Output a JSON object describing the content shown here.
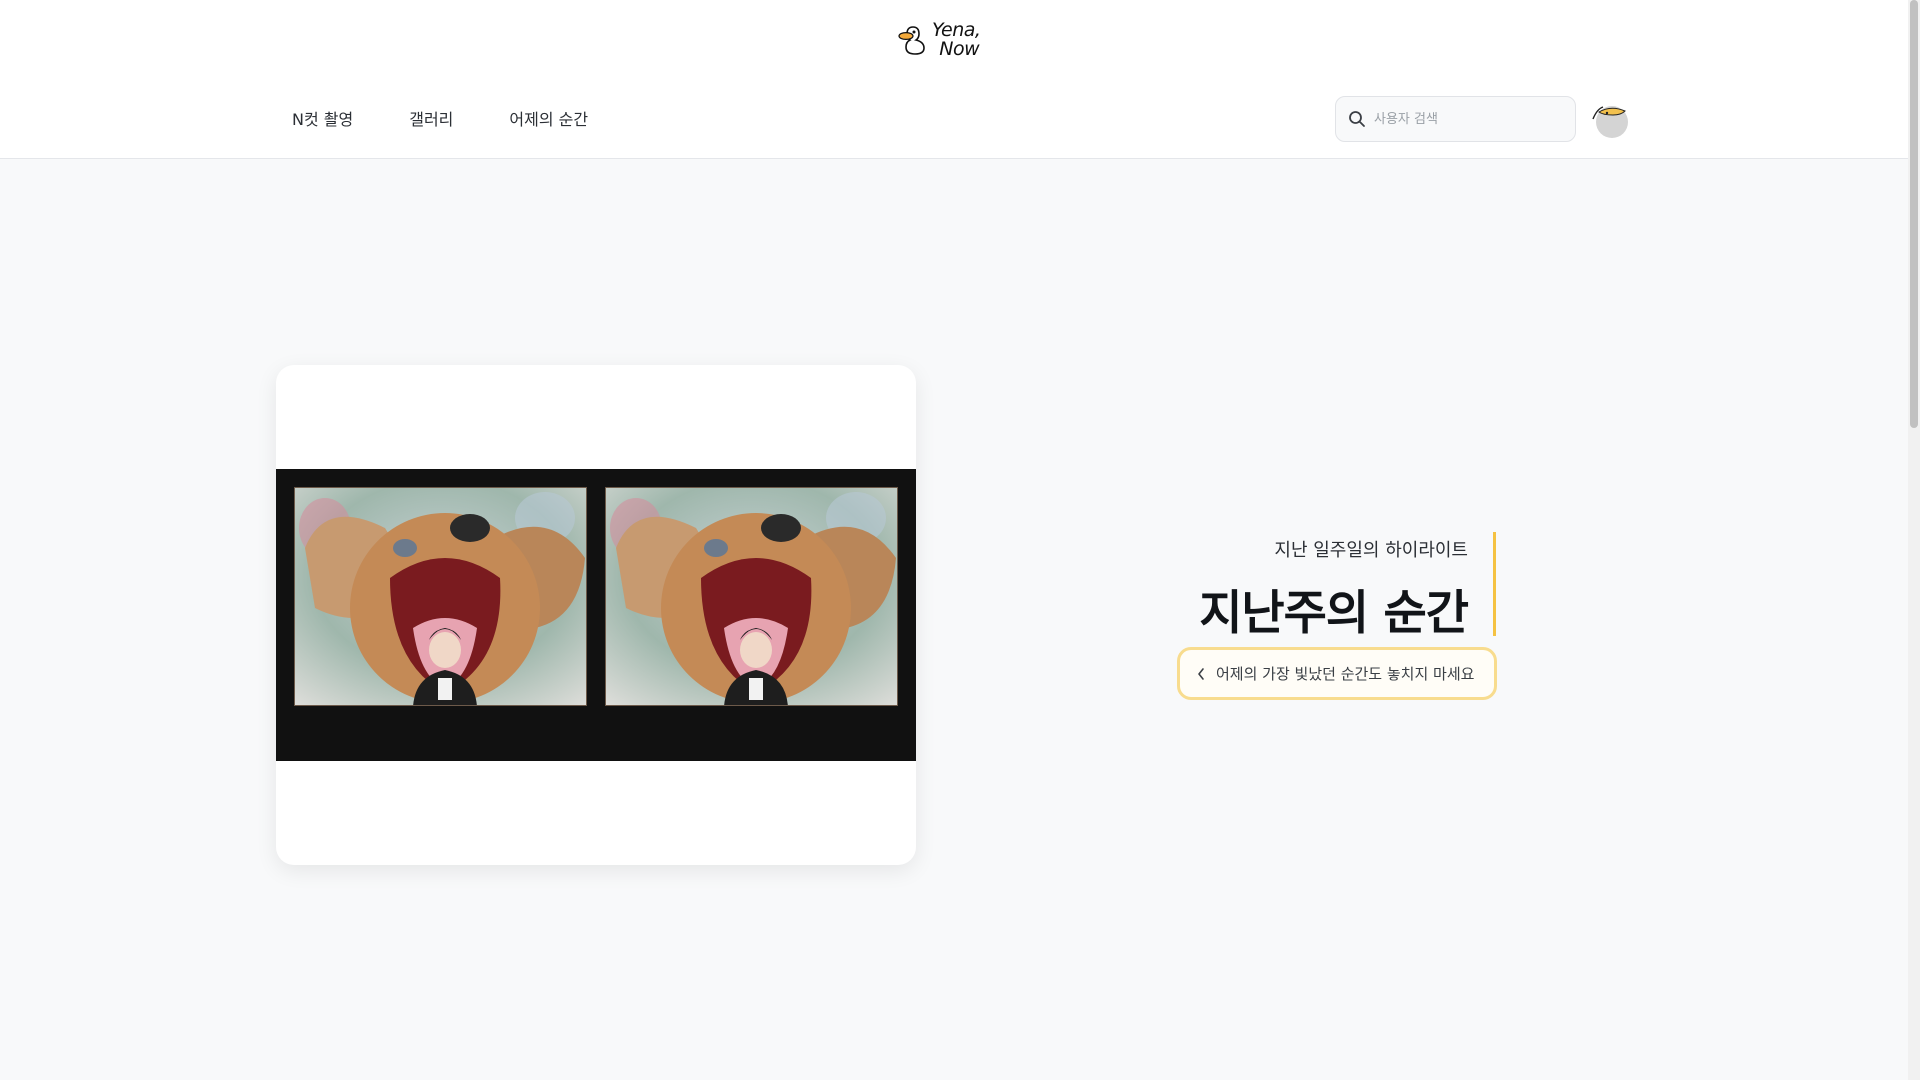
{
  "header": {
    "logo": {
      "line1": "Yena,",
      "line2": "Now"
    },
    "nav": [
      {
        "label": "N컷 촬영"
      },
      {
        "label": "갤러리"
      },
      {
        "label": "어제의 순간"
      }
    ],
    "search": {
      "placeholder": "사용자 검색",
      "value": ""
    }
  },
  "hero": {
    "subtitle": "지난 일주일의 하이라이트",
    "title": "지난주의 순간",
    "button_label": "어제의 가장 빛났던 순간도 놓치지 마세요"
  },
  "colors": {
    "accent": "#f5c242",
    "button_border": "#f8dc8e",
    "photo_strip": "#111111"
  },
  "icons": {
    "logo": "duck-logo-icon",
    "search": "search-icon",
    "avatar": "duck-avatar-icon",
    "button": "chevron-left-icon"
  }
}
